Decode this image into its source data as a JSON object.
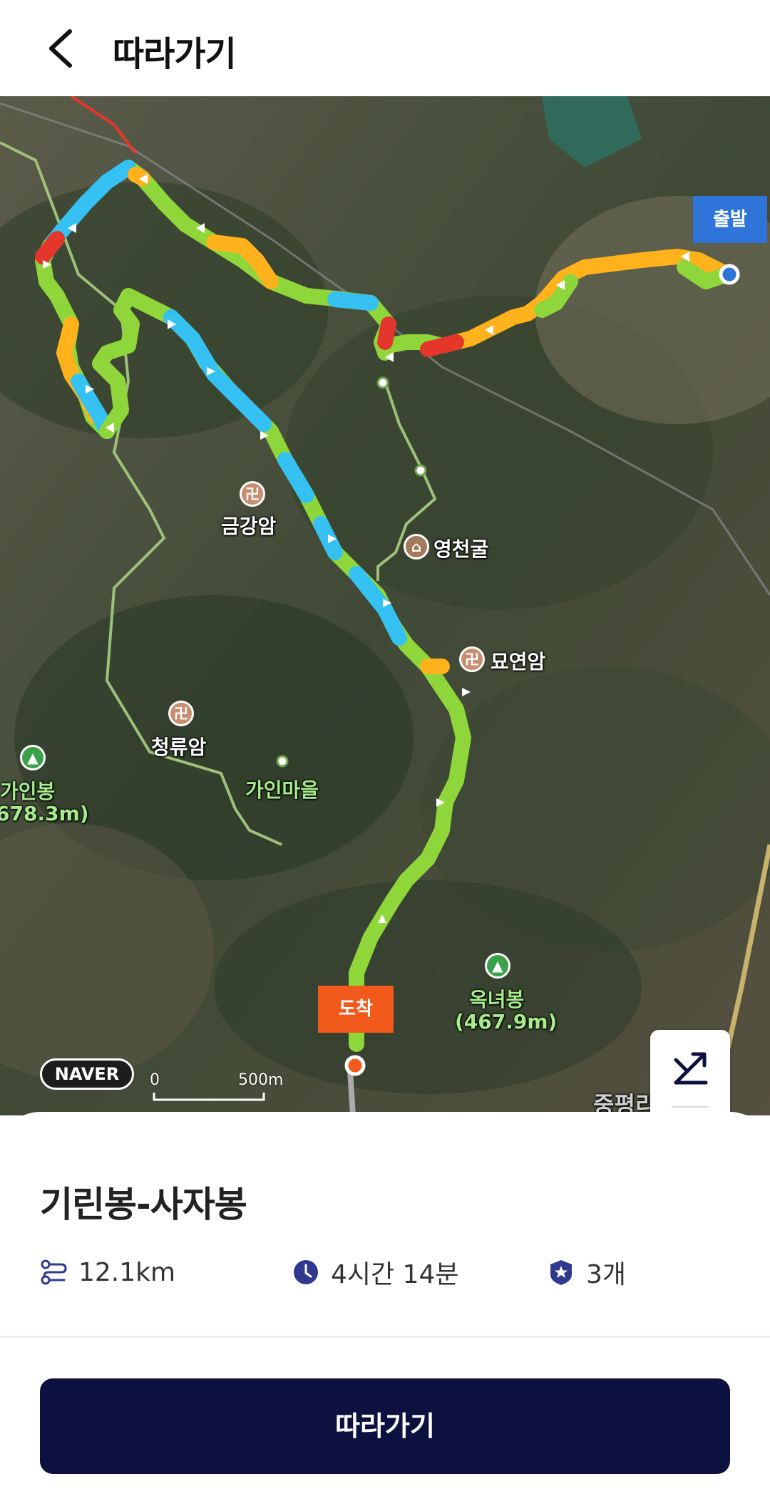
{
  "header": {
    "title": "따라가기"
  },
  "map": {
    "start_label": "출발",
    "end_label": "도착",
    "provider": "NAVER",
    "scale_zero": "0",
    "scale_distance": "500m",
    "faded_label": "중평리",
    "pois": [
      {
        "name": "금강암",
        "type": "temple"
      },
      {
        "name": "영천굴",
        "type": "cave"
      },
      {
        "name": "묘연암",
        "type": "temple"
      },
      {
        "name": "청류암",
        "type": "temple"
      },
      {
        "name": "가인마을",
        "type": "village"
      },
      {
        "name": "가인봉",
        "elevation": "678.3m)",
        "type": "peak"
      },
      {
        "name": "옥녀봉",
        "elevation": "(467.9m)",
        "type": "peak"
      }
    ],
    "controls": {
      "elevation_icon": "elevation-chart-icon",
      "swap_icon": "swap-arrows-icon"
    },
    "route_colors": {
      "green": "#8fd63a",
      "orange": "#ffb21c",
      "blue": "#35c2f2",
      "red": "#e5362b",
      "trail": "#9fc07a"
    }
  },
  "route": {
    "name": "기린봉-사자봉",
    "distance": "12.1km",
    "duration": "4시간 14분",
    "badges": "3개"
  },
  "cta": {
    "label": "따라가기"
  },
  "colors": {
    "cta_bg": "#0c1140",
    "icon_navy": "#2f3a8f"
  }
}
